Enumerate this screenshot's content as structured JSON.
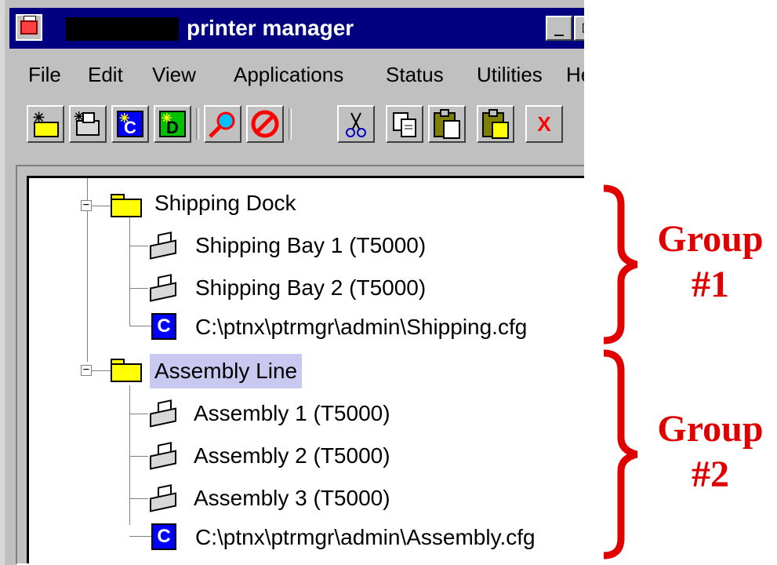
{
  "window": {
    "title": "printer manager",
    "app_icon": "printer-manager-app-icon",
    "controls": {
      "minimize_label": "_",
      "maximize_label": "□"
    }
  },
  "menu": {
    "items": [
      "File",
      "Edit",
      "View",
      "Applications",
      "Status",
      "Utilities",
      "He"
    ]
  },
  "toolbar": {
    "buttons": [
      {
        "name": "new-folder-button",
        "icon": "new-folder-icon"
      },
      {
        "name": "new-printer-button",
        "icon": "new-printer-icon"
      },
      {
        "name": "new-config-button",
        "icon": "new-config-icon"
      },
      {
        "name": "new-device-button",
        "icon": "new-device-icon"
      },
      {
        "name": "find-button",
        "icon": "magnifier-icon"
      },
      {
        "name": "stop-button",
        "icon": "stop-icon"
      },
      {
        "name": "cut-button",
        "icon": "scissors-icon"
      },
      {
        "name": "copy-button",
        "icon": "copy-icon"
      },
      {
        "name": "paste-button",
        "icon": "paste-icon"
      },
      {
        "name": "paste-special-button",
        "icon": "paste-special-icon"
      },
      {
        "name": "delete-button",
        "icon": "delete-icon",
        "label": "X"
      }
    ]
  },
  "tree": {
    "expander_collapse": "−",
    "config_icon_letter": "C",
    "groups": [
      {
        "label": "Shipping Dock",
        "children": [
          {
            "type": "printer",
            "label": "Shipping Bay 1 (T5000)"
          },
          {
            "type": "printer",
            "label": "Shipping Bay 2 (T5000)"
          },
          {
            "type": "config",
            "label": "C:\\ptnx\\ptrmgr\\admin\\Shipping.cfg"
          }
        ]
      },
      {
        "label": "Assembly Line",
        "selected": true,
        "children": [
          {
            "type": "printer",
            "label": "Assembly 1 (T5000)"
          },
          {
            "type": "printer",
            "label": "Assembly 2 (T5000)"
          },
          {
            "type": "printer",
            "label": "Assembly 3 (T5000)"
          },
          {
            "type": "config",
            "label": "C:\\ptnx\\ptrmgr\\admin\\Assembly.cfg"
          }
        ]
      }
    ]
  },
  "annotations": {
    "color": "#e00000",
    "group1": {
      "line1": "Group",
      "line2": "#1"
    },
    "group2": {
      "line1": "Group",
      "line2": "#2"
    }
  }
}
